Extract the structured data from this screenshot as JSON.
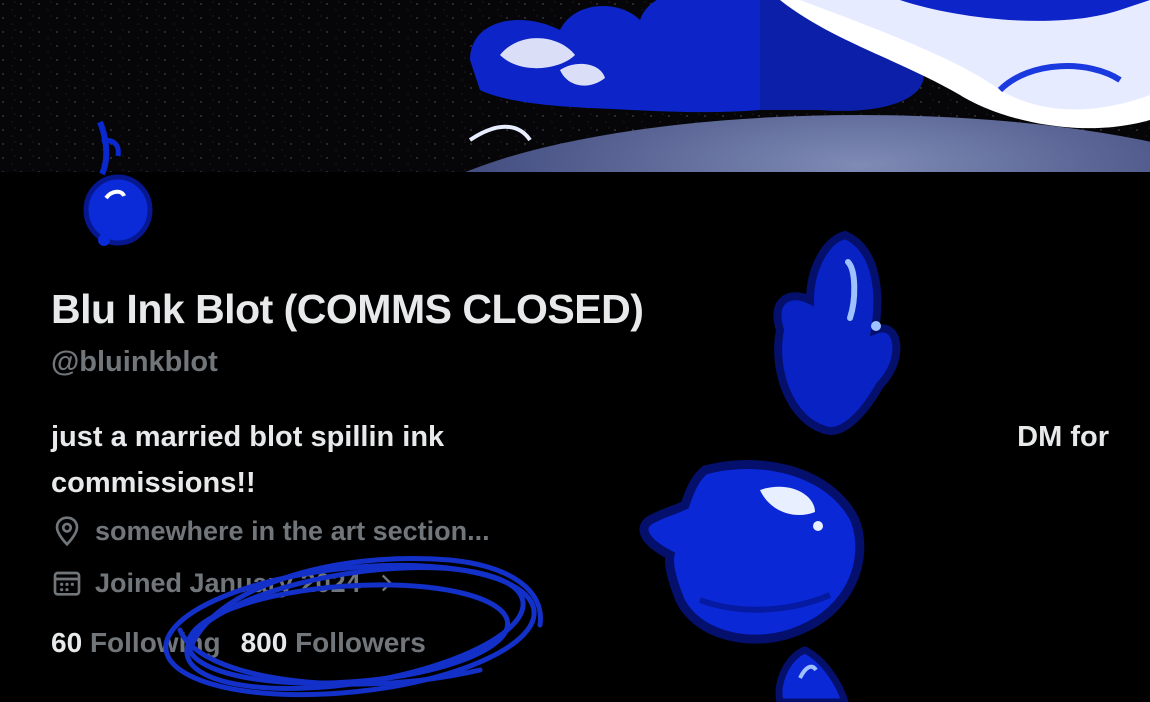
{
  "profile": {
    "display_name": "Blu Ink Blot (COMMS CLOSED)",
    "handle": "@bluinkblot",
    "bio_line1_left": "just a married blot spillin ink",
    "bio_line1_right": "DM for",
    "bio_line2": "commissions!!",
    "location": "somewhere in the art section...",
    "joined": "Joined January 2024",
    "following_count": "60",
    "following_label": "Following",
    "followers_count": "800",
    "followers_label": "Followers"
  },
  "icons": {
    "location": "location-pin-icon",
    "joined": "calendar-icon",
    "joined_chevron": "chevron-right-icon"
  },
  "colors": {
    "background": "#000000",
    "text_primary": "#e7e9ea",
    "text_secondary": "#71767b",
    "ink_blue": "#0a2bd6",
    "scribble_blue": "#1330c8"
  }
}
